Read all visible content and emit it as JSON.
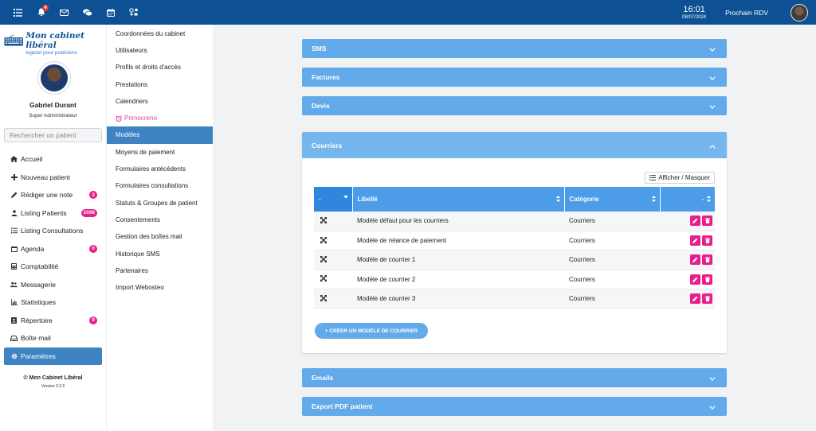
{
  "topbar": {
    "notification_count": "4",
    "time": "16:01",
    "date": "08/07/2024",
    "next_appointment_label": "Prochain RDV"
  },
  "logo": {
    "title": "Mon cabinet libéral",
    "subtitle": "logiciel pour praticiens"
  },
  "profile": {
    "name": "Gabriel Durant",
    "role": "Super Administrateur"
  },
  "search": {
    "placeholder": "Rechercher un patient"
  },
  "nav": [
    {
      "label": "Accueil",
      "icon": "home-icon"
    },
    {
      "label": "Nouveau patient",
      "icon": "plus-icon"
    },
    {
      "label": "Rédiger une note",
      "icon": "pencil-icon",
      "badge": "3"
    },
    {
      "label": "Listing Patients",
      "icon": "users-icon",
      "badge": "1098"
    },
    {
      "label": "Listing Consultations",
      "icon": "list-icon"
    },
    {
      "label": "Agenda",
      "icon": "calendar-icon",
      "badge": "0"
    },
    {
      "label": "Comptabilité",
      "icon": "calculator-icon"
    },
    {
      "label": "Messagerie",
      "icon": "chat-users-icon"
    },
    {
      "label": "Statistiques",
      "icon": "bar-chart-icon"
    },
    {
      "label": "Répertoire",
      "icon": "address-book-icon",
      "badge": "9"
    },
    {
      "label": "Boîte mail",
      "icon": "inbox-icon"
    },
    {
      "label": "Paramètres",
      "icon": "gear-icon",
      "active": true
    }
  ],
  "footer": {
    "copyright": "© Mon Cabinet Libéral",
    "version": "Version 3.3.9"
  },
  "settings_menu": [
    {
      "label": "Coordonnées du cabinet"
    },
    {
      "label": "Utilisateurs"
    },
    {
      "label": "Profils et droits d'accès"
    },
    {
      "label": "Prestations"
    },
    {
      "label": "Calendriers"
    },
    {
      "label": "Primocreno",
      "pink": true
    },
    {
      "label": "Modèles",
      "active": true
    },
    {
      "label": "Moyens de paiement"
    },
    {
      "label": "Formulaires antécédents"
    },
    {
      "label": "Formulaires consultations"
    },
    {
      "label": "Statuts & Groupes de patient"
    },
    {
      "label": "Consentements"
    },
    {
      "label": "Gestion des boîtes mail"
    },
    {
      "label": "Historique SMS"
    },
    {
      "label": "Partenaires"
    },
    {
      "label": "Import Webosteo"
    }
  ],
  "sections": {
    "sms": "SMS",
    "factures": "Factures",
    "devis": "Devis",
    "courriers": "Courriers",
    "emails": "Emails",
    "export_pdf": "Export PDF patient"
  },
  "courriers": {
    "toggle_columns_label": "Afficher / Masquer",
    "columns": {
      "first": "-",
      "libelle": "Libellé",
      "categorie": "Catégorie",
      "actions": "-"
    },
    "rows": [
      {
        "libelle": "Modèle défaut pour les courriers",
        "categorie": "Courriers"
      },
      {
        "libelle": "Modèle de relance de paiement",
        "categorie": "Courriers"
      },
      {
        "libelle": "Modèle de courrier 1",
        "categorie": "Courriers"
      },
      {
        "libelle": "Modèle de courrier 2",
        "categorie": "Courriers"
      },
      {
        "libelle": "Modèle de courrier 3",
        "categorie": "Courriers"
      }
    ],
    "create_button": "+ CRÉER UN MODÈLE DE COURRIER"
  },
  "colors": {
    "topbar": "#0d5194",
    "accordion": "#63aaea",
    "table_header": "#4c9ce8",
    "active_nav": "#3f84c2",
    "badge": "#e91e8c"
  }
}
